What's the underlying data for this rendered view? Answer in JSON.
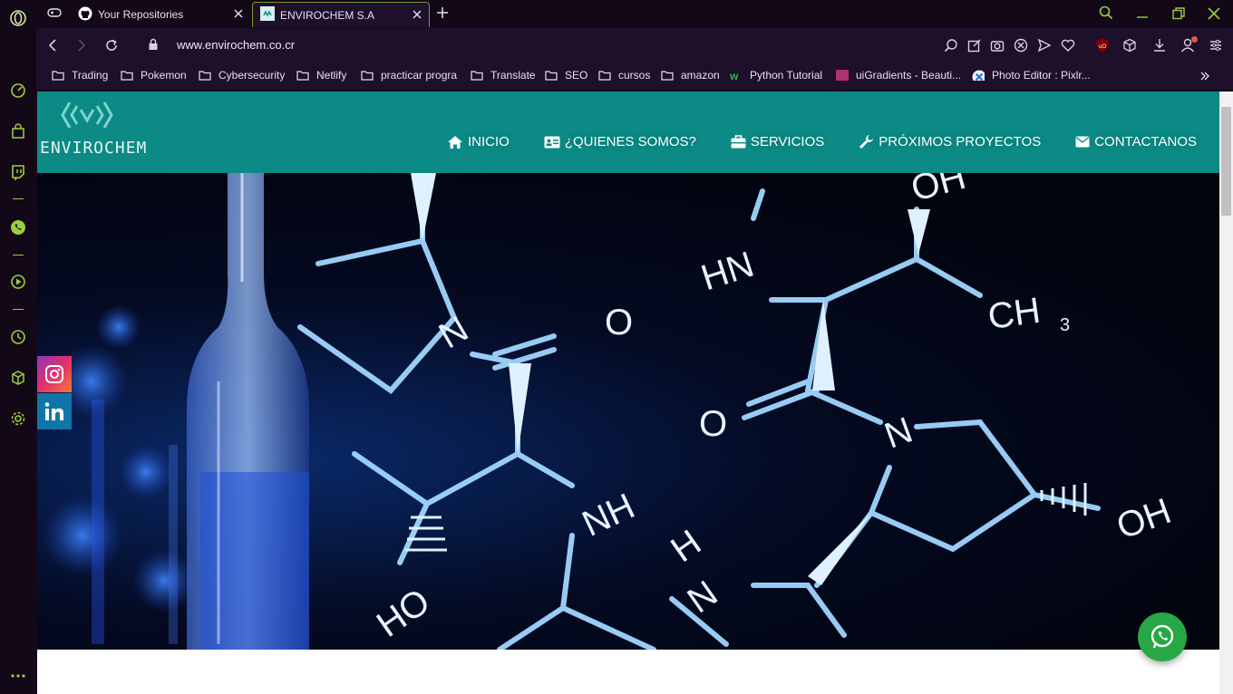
{
  "browser": {
    "tabs": [
      {
        "title": "Your Repositories",
        "icon": "github-icon",
        "active": false
      },
      {
        "title": "ENVIROCHEM S.A",
        "icon": "envirochem-favicon",
        "active": true
      }
    ],
    "address": "www.envirochem.co.cr",
    "bookmarks": [
      {
        "label": "Trading",
        "icon": "folder-icon"
      },
      {
        "label": "Pokemon",
        "icon": "folder-icon"
      },
      {
        "label": "Cybersecurity",
        "icon": "folder-icon"
      },
      {
        "label": "Netlify",
        "icon": "folder-icon"
      },
      {
        "label": "practicar progra",
        "icon": "folder-icon"
      },
      {
        "label": "Translate",
        "icon": "folder-icon"
      },
      {
        "label": "SEO",
        "icon": "folder-icon"
      },
      {
        "label": "cursos",
        "icon": "folder-icon"
      },
      {
        "label": "amazon",
        "icon": "folder-icon"
      },
      {
        "label": "Python Tutorial",
        "icon": "w3schools-icon"
      },
      {
        "label": "uiGradients - Beauti...",
        "icon": "uigradients-icon"
      },
      {
        "label": "Photo Editor : Pixlr...",
        "icon": "pixlr-icon"
      }
    ],
    "colors": {
      "accent": "#9ccf3a",
      "chrome": "#1e0f2a"
    }
  },
  "site": {
    "logo_text": "ENVIROCHEM",
    "nav": [
      {
        "label": "INICIO",
        "icon": "home-icon"
      },
      {
        "label": "¿QUIENES SOMOS?",
        "icon": "id-card-icon"
      },
      {
        "label": "SERVICIOS",
        "icon": "briefcase-icon"
      },
      {
        "label": "PRÓXIMOS PROYECTOS",
        "icon": "wrench-icon"
      },
      {
        "label": "CONTACTANOS",
        "icon": "envelope-icon"
      }
    ],
    "hero": {
      "molecule_labels": [
        "HN",
        "CH",
        "3",
        "O",
        "N",
        "O",
        "N",
        "NH",
        "H",
        "N",
        "OH",
        "HO",
        "OH"
      ]
    },
    "social": [
      {
        "name": "instagram",
        "icon": "instagram-icon",
        "color": "#d6246e"
      },
      {
        "name": "linkedin",
        "icon": "linkedin-icon",
        "color": "#0e76a8"
      }
    ],
    "colors": {
      "header": "#0c8a85",
      "whatsapp": "#25a845"
    }
  }
}
